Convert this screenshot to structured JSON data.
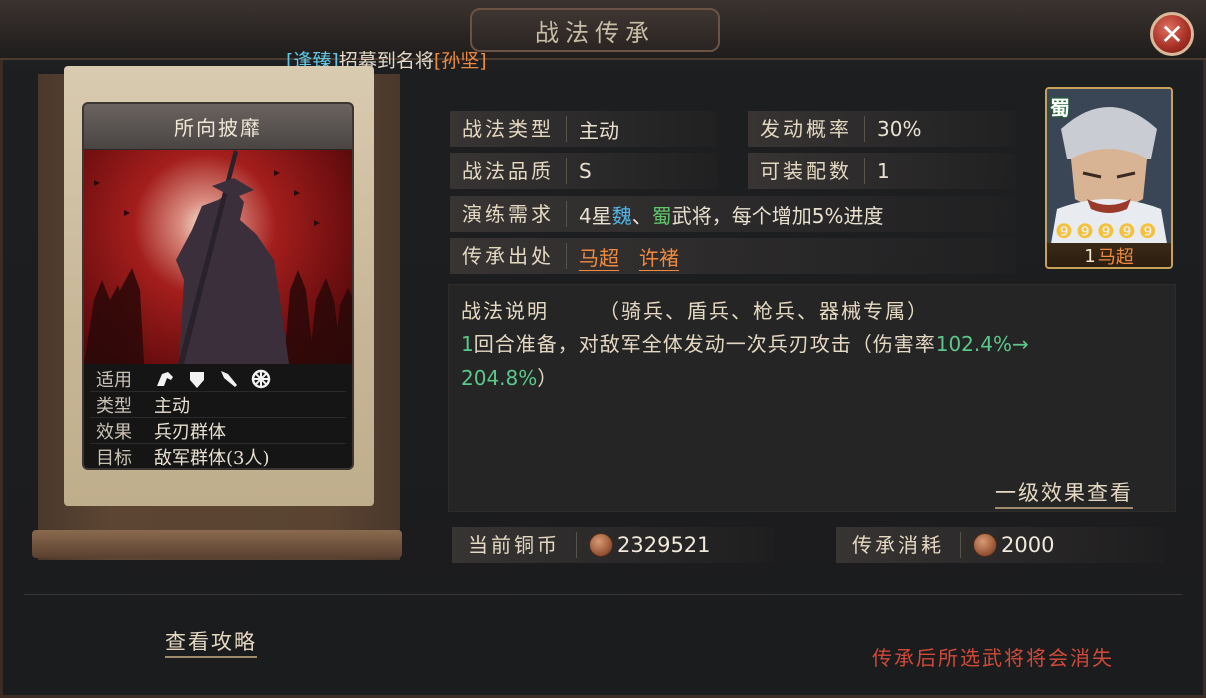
{
  "header": {
    "title": "战法传承",
    "close_icon": "close-icon"
  },
  "notice": {
    "bracket_name": "[逢臻]",
    "middle": "招募到名将",
    "general": "[孙坚]"
  },
  "skill_card": {
    "name": "所向披靡",
    "rows": [
      {
        "key": "适用",
        "icons": [
          "cavalry-icon",
          "shield-icon",
          "spear-icon",
          "siege-icon"
        ]
      },
      {
        "key": "类型",
        "value": "主动"
      },
      {
        "key": "效果",
        "value": "兵刃群体"
      },
      {
        "key": "目标",
        "value": "敌军群体(3人)"
      }
    ]
  },
  "info": {
    "type_label": "战法类型",
    "type_value": "主动",
    "rate_label": "发动概率",
    "rate_value": "30%",
    "quality_label": "战法品质",
    "quality_value": "S",
    "equip_label": "可装配数",
    "equip_value": "1",
    "train_label": "演练需求",
    "train_prefix": "4星",
    "train_wei": "魏",
    "train_sep": "、",
    "train_shu": "蜀",
    "train_suffix": "武将，每个增加5%进度",
    "origin_label": "传承出处",
    "origin_links": [
      "马超",
      "许褚"
    ]
  },
  "portrait": {
    "faction": "蜀",
    "stars": 5,
    "level": "1",
    "name": "马超"
  },
  "description": {
    "title": "战法说明",
    "tags": "（骑兵、盾兵、枪兵、器械专属）",
    "line1_num": "1",
    "line1_text": "回合准备，对敌军全体发动一次兵刃攻击（伤害率",
    "line1_value": "102.4%→",
    "line2_value": "204.8%",
    "line2_end": "）",
    "view_effect_link": "一级效果查看"
  },
  "coins": {
    "current_label": "当前铜币",
    "current_value": "2329521",
    "cost_label": "传承消耗",
    "cost_value": "2000"
  },
  "footer": {
    "guide_link": "查看攻略",
    "warning": "传承后所选武将将会消失"
  },
  "colors": {
    "accent_orange": "#ef8a3e",
    "accent_blue": "#5ec8e6",
    "accent_green": "#5ac88a",
    "warning_red": "#d24a3a"
  }
}
